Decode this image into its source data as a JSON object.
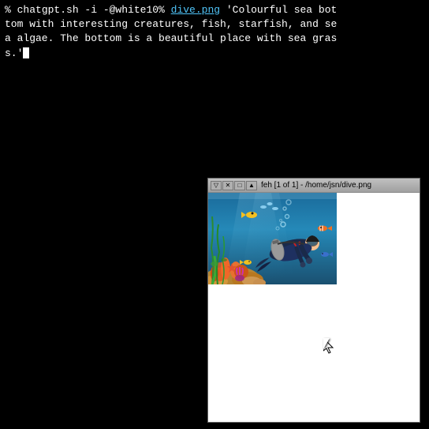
{
  "terminal": {
    "prompt": "%",
    "command": " chatgpt.sh -i -@white10% dive.png 'Colourful sea bottom with interesting creatures, fish, starfish, and sea algae. The bottom is a beautiful place with sea gras s.'",
    "lines": [
      "% chatgpt.sh -i -@white10% dive.png 'Colourful sea bot",
      "tom with interesting creatures, fish, starfish, and se",
      "a algae. The bottom is a beautiful place with sea gras",
      "s.'"
    ]
  },
  "feh_window": {
    "title": "feh [1 of 1] - /home/jsn/dive.png",
    "buttons": [
      "▽",
      "✕",
      "□",
      "▲"
    ],
    "image_alt": "Underwater scene with scuba diver"
  },
  "icons": {
    "minimize": "▽",
    "close": "✕",
    "maximize": "□",
    "shade": "▲"
  }
}
